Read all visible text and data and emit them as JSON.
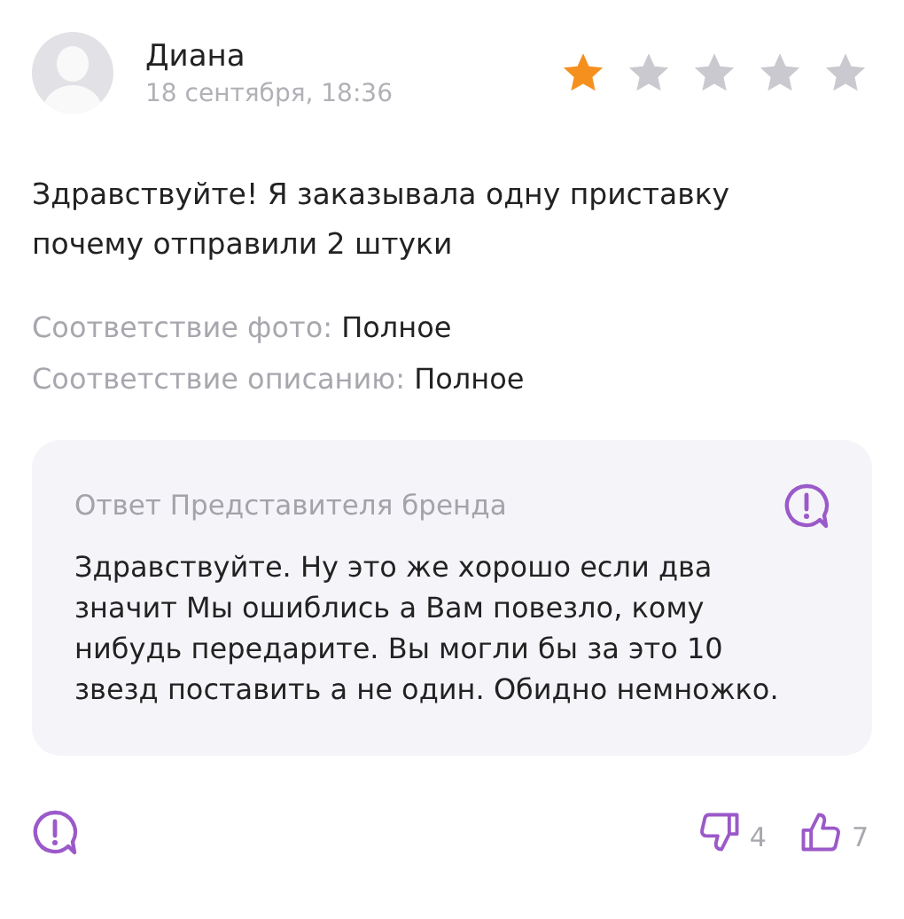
{
  "review": {
    "author": "Диана",
    "date": "18 сентября, 18:36",
    "stars": 1,
    "text": "Здравствуйте! Я заказывала одну приставку почему отправили 2 штуки",
    "matches": [
      {
        "label": "Соответствие фото:",
        "value": "Полное"
      },
      {
        "label": "Соответствие описанию:",
        "value": "Полное"
      }
    ]
  },
  "reply": {
    "title": "Ответ Представителя бренда",
    "text": "Здравствуйте. Ну это же хорошо если два значит Мы ошиблись а Вам повезло, кому нибудь передарите. Вы могли бы за это 10 звезд поставить а не один. Обидно немножко."
  },
  "footer": {
    "dislikes": "4",
    "likes": "7"
  }
}
